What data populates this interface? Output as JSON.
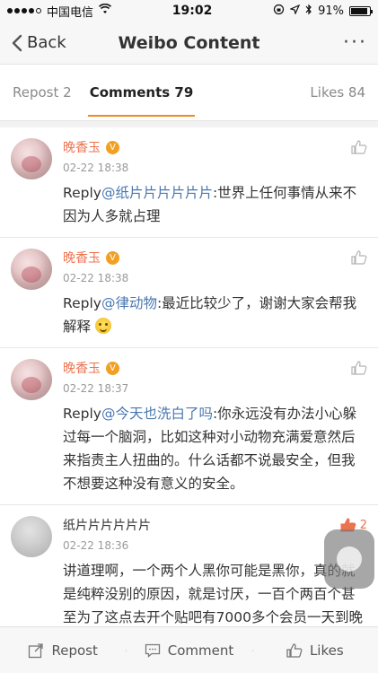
{
  "status": {
    "carrier": "中国电信",
    "time": "19:02",
    "battery": "91%",
    "battery_level": 0.91
  },
  "nav": {
    "back_label": "Back",
    "title": "Weibo Content",
    "more_label": "···"
  },
  "tabs": {
    "repost": "Repost 2",
    "comments": "Comments 79",
    "likes": "Likes 84"
  },
  "comments": [
    {
      "name": "晚香玉",
      "badge": "V",
      "time": "02-22 18:38",
      "reply_prefix": "Reply",
      "mention": "@纸片片片片片片",
      "text": ":世界上任何事情从来不因为人多就占理",
      "like_count": ""
    },
    {
      "name": "晚香玉",
      "badge": "V",
      "time": "02-22 18:38",
      "reply_prefix": "Reply",
      "mention": "@律动物",
      "text": ":最近比较少了，谢谢大家会帮我解释",
      "like_count": ""
    },
    {
      "name": "晚香玉",
      "badge": "V",
      "time": "02-22 18:37",
      "reply_prefix": "Reply",
      "mention": "@今天也洗白了吗",
      "text": ":你永远没有办法小心躲过每一个脑洞，比如这种对小动物充满爱意然后来指责主人扭曲的。什么话都不说最安全，但我不想要这种没有意义的安全。",
      "like_count": ""
    },
    {
      "name": "纸片片片片片片",
      "time": "02-22 18:36",
      "text": "讲道理啊，一个两个人黑你可能是黑你，真的就是纯粹没别的原因，就是讨厌，一百个两百个甚至为了这点去开个贴吧有7000多个会员一天到晚来讨论你，可以考虑客观的从自己身上找找问题了。",
      "like_count": "2"
    }
  ],
  "bottom": {
    "repost": "Repost",
    "comment": "Comment",
    "likes": "Likes"
  },
  "colors": {
    "accent": "#f08a24",
    "name": "#eb7350",
    "mention": "#4a77b0"
  }
}
